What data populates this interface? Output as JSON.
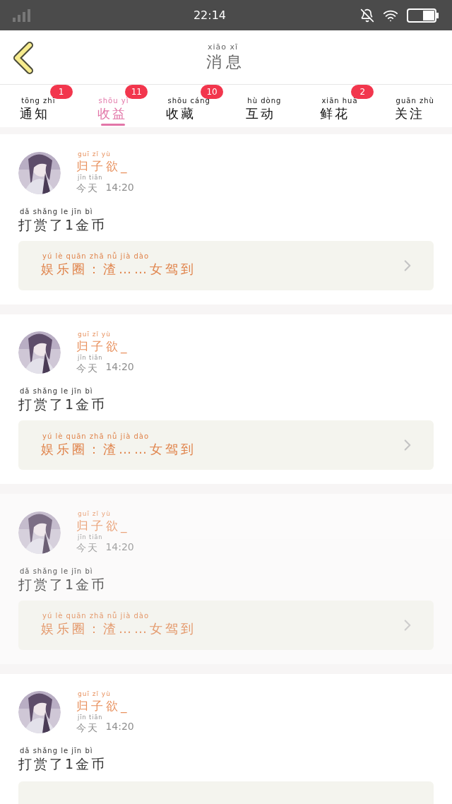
{
  "status_bar": {
    "time": "22:14"
  },
  "header": {
    "title": "消息",
    "title_pinyin": "xiāo xī"
  },
  "tabs": [
    {
      "label": "通知",
      "pinyin": "tōng zhī",
      "badge": "1",
      "selected": false
    },
    {
      "label": "收益",
      "pinyin": "shōu yì",
      "badge": "11",
      "selected": true
    },
    {
      "label": "收藏",
      "pinyin": "shōu cáng",
      "badge": "10",
      "selected": false
    },
    {
      "label": "互动",
      "pinyin": "hù dòng",
      "selected": false
    },
    {
      "label": "鲜花",
      "pinyin": "xiān huā",
      "badge": "2",
      "selected": false
    },
    {
      "label": "关注",
      "pinyin": "guān zhù",
      "selected": false
    }
  ],
  "messages": [
    {
      "name": "归子欲_",
      "name_pinyin": "guī zǐ yù",
      "day": "今天",
      "day_pinyin": "jīn tiān",
      "clock": "14:20",
      "text": "打赏了1金币",
      "text_pinyin": "dǎ shǎng le jīn bì",
      "link": {
        "text": "娱乐圈：渣……女驾到",
        "pinyin": "yú lè quān zhā nǚ jià dào"
      },
      "dimmed": false
    },
    {
      "name": "归子欲_",
      "name_pinyin": "guī zǐ yù",
      "day": "今天",
      "day_pinyin": "jīn tiān",
      "clock": "14:20",
      "text": "打赏了1金币",
      "text_pinyin": "dǎ shǎng le jīn bì",
      "link": {
        "text": "娱乐圈：渣……女驾到",
        "pinyin": "yú lè quān zhā nǚ jià dào"
      },
      "dimmed": false
    },
    {
      "name": "归子欲_",
      "name_pinyin": "guī zǐ yù",
      "day": "今天",
      "day_pinyin": "jīn tiān",
      "clock": "14:20",
      "text": "打赏了1金币",
      "text_pinyin": "dǎ shǎng le jīn bì",
      "link": {
        "text": "娱乐圈：渣……女驾到",
        "pinyin": "yú lè quān zhā nǚ jià dào"
      },
      "dimmed": true
    },
    {
      "name": "归子欲_",
      "name_pinyin": "guī zǐ yù",
      "day": "今天",
      "day_pinyin": "jīn tiān",
      "clock": "14:20",
      "text": "打赏了1金币",
      "text_pinyin": "dǎ shǎng le jīn bì",
      "dimmed": false
    }
  ]
}
